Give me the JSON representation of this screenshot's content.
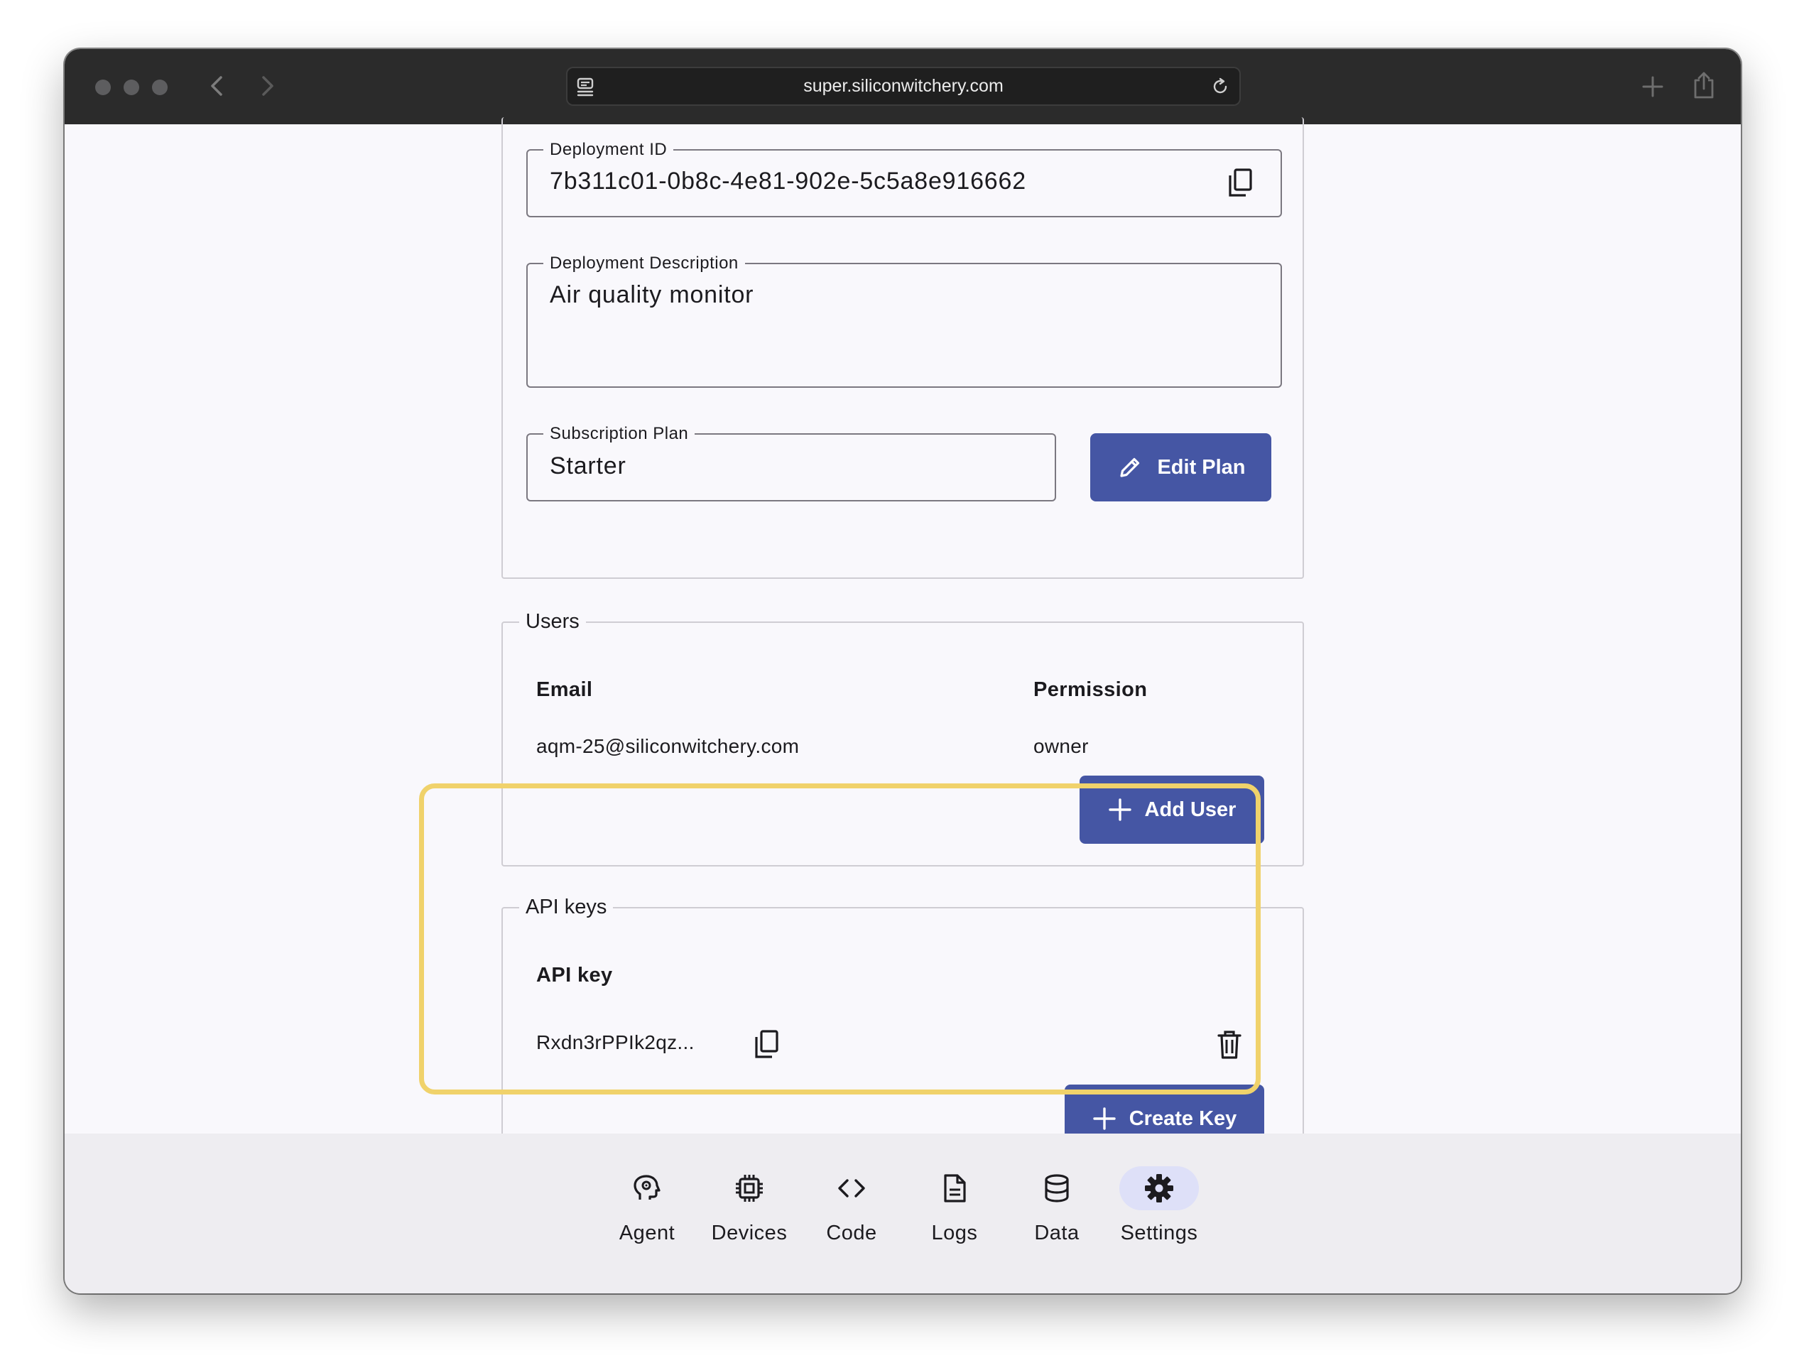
{
  "browser": {
    "url": "super.siliconwitchery.com"
  },
  "deployment": {
    "id_label": "Deployment ID",
    "id_value": "7b311c01-0b8c-4e81-902e-5c5a8e916662",
    "description_label": "Deployment Description",
    "description_value": "Air quality monitor",
    "plan_label": "Subscription Plan",
    "plan_value": "Starter",
    "edit_plan_label": "Edit Plan"
  },
  "users": {
    "legend": "Users",
    "headers": {
      "email": "Email",
      "permission": "Permission"
    },
    "rows": [
      {
        "email": "aqm-25@siliconwitchery.com",
        "permission": "owner"
      }
    ],
    "add_user_label": "Add User"
  },
  "api_keys": {
    "legend": "API keys",
    "header": "API key",
    "rows": [
      {
        "key": "Rxdn3rPPIk2qz..."
      }
    ],
    "create_key_label": "Create Key"
  },
  "bottom_nav": {
    "items": [
      {
        "label": "Agent",
        "icon": "agent-head-icon"
      },
      {
        "label": "Devices",
        "icon": "chip-icon"
      },
      {
        "label": "Code",
        "icon": "code-icon"
      },
      {
        "label": "Logs",
        "icon": "document-icon"
      },
      {
        "label": "Data",
        "icon": "database-icon"
      },
      {
        "label": "Settings",
        "icon": "gear-icon",
        "active": true
      }
    ]
  },
  "colors": {
    "primary": "#4556a4",
    "highlight": "#f0d26b",
    "active_nav": "#dee0f8",
    "titlebar": "#2b2b2b"
  }
}
